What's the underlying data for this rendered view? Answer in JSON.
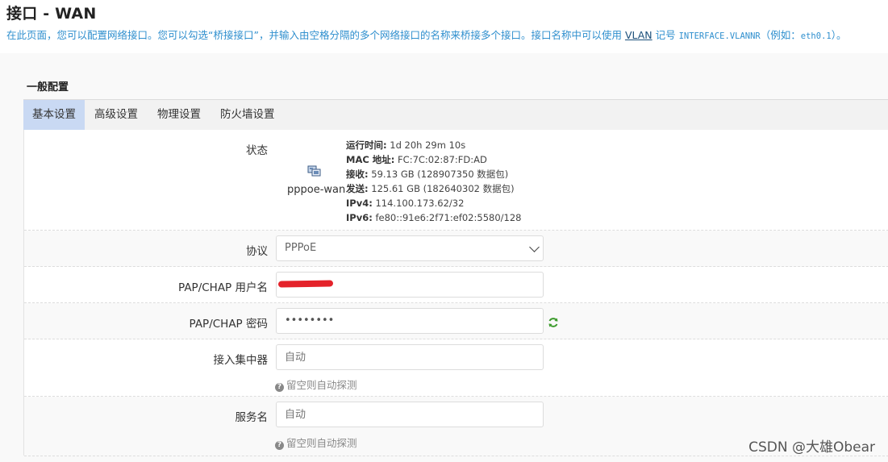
{
  "page": {
    "title": "接口 - WAN",
    "desc_before": "在此页面，您可以配置网络接口。您可以勾选“桥接接口”，并输入由空格分隔的多个网络接口的名称来桥接多个接口。接口名称中可以使用 ",
    "desc_vlan": "VLAN",
    "desc_mid": " 记号 ",
    "desc_code": "INTERFACE.VLANNR",
    "desc_after": "（例如：",
    "desc_example": "eth0.1",
    "desc_end": "）。"
  },
  "section": {
    "title": "一般配置"
  },
  "tabs": [
    {
      "label": "基本设置",
      "active": true
    },
    {
      "label": "高级设置",
      "active": false
    },
    {
      "label": "物理设置",
      "active": false
    },
    {
      "label": "防火墙设置",
      "active": false
    }
  ],
  "status": {
    "label": "状态",
    "icon": "network-interface-icon",
    "interface": "pppoe-wan",
    "details": [
      {
        "key": "运行时间:",
        "value": " 1d 20h 29m 10s"
      },
      {
        "key": "MAC 地址:",
        "value": " FC:7C:02:87:FD:AD"
      },
      {
        "key": "接收:",
        "value": " 59.13 GB (128907350 数据包)"
      },
      {
        "key": "发送:",
        "value": " 125.61 GB (182640302 数据包)"
      },
      {
        "key": "IPv4:",
        "value": " 114.100.173.62/32"
      },
      {
        "key": "IPv6:",
        "value": " fe80::91e6:2f71:ef02:5580/128"
      }
    ]
  },
  "protocol": {
    "label": "协议",
    "value": "PPPoE"
  },
  "username": {
    "label": "PAP/CHAP 用户名",
    "value": ""
  },
  "password": {
    "label": "PAP/CHAP 密码",
    "value": "••••••••",
    "reveal_icon": "refresh-icon"
  },
  "concentrator": {
    "label": "接入集中器",
    "placeholder": "自动",
    "hint": "留空则自动探测"
  },
  "service": {
    "label": "服务名",
    "placeholder": "自动",
    "hint": "留空则自动探测"
  },
  "watermark": "CSDN @大雄Obear",
  "colors": {
    "accent": "#2f8fce",
    "active_tab": "#c9d9f3",
    "redaction": "#e4222a",
    "refresh_icon": "#3a9a2a"
  }
}
